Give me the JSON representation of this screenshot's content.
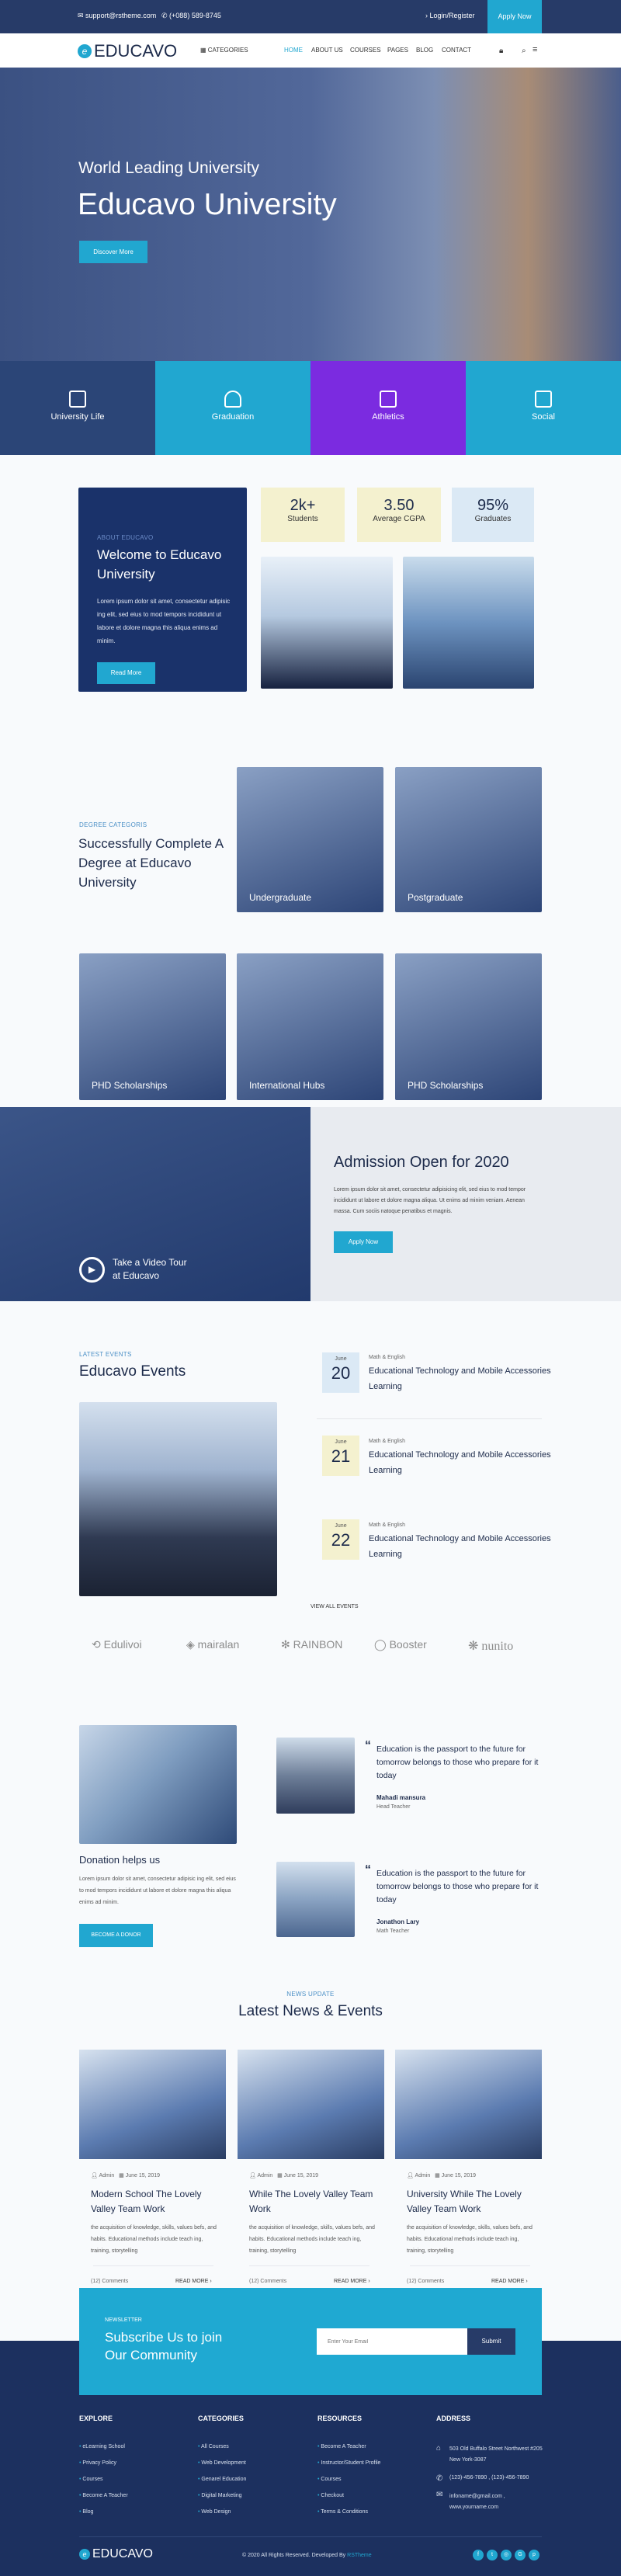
{
  "topbar": {
    "email": "support@rstheme.com",
    "phone": "(+088) 589-8745",
    "login": "Login/Register",
    "apply": "Apply Now"
  },
  "nav": {
    "logo": "EDUCAVO",
    "categories": "CATEGORIES",
    "links": [
      "HOME",
      "ABOUT US",
      "COURSES",
      "PAGES",
      "BLOG",
      "CONTACT"
    ],
    "active": "HOME"
  },
  "hero": {
    "subtitle": "World Leading University",
    "title": "Educavo University",
    "button": "Discover More"
  },
  "tiles": [
    {
      "label": "University Life",
      "color": "#2b4577"
    },
    {
      "label": "Graduation",
      "color": "#21a7d0"
    },
    {
      "label": "Athletics",
      "color": "#7b2be0"
    },
    {
      "label": "Social",
      "color": "#21a7d0"
    }
  ],
  "about": {
    "label": "ABOUT EDUCAVO",
    "title": "Welcome to Educavo University",
    "text": "Lorem ipsum dolor sit amet, consectetur adipisic ing elit, sed eius to mod tempors incididunt ut labore et dolore magna this aliqua enims ad minim.",
    "button": "Read More",
    "stats": [
      {
        "value": "2k+",
        "label": "Students"
      },
      {
        "value": "3.50",
        "label": "Average CGPA"
      },
      {
        "value": "95%",
        "label": "Graduates"
      }
    ]
  },
  "degree": {
    "label": "DEGREE CATEGORIS",
    "title": "Successfully Complete A Degree at Educavo University",
    "cards": [
      "Undergraduate",
      "Postgraduate",
      "PHD Scholarships",
      "International Hubs",
      "PHD Scholarships"
    ]
  },
  "admission": {
    "video": "Take a Video Tour at Educavo",
    "title": "Admission Open for 2020",
    "text": "Lorem ipsum dolor sit amet, consectetur adipisicing elit, sed eius to mod tempor incididunt ut labore et dolore magna aliqua. Ut enims ad minim veniam. Aenean massa. Cum sociis natoque penatibus et magnis.",
    "button": "Apply Now"
  },
  "events": {
    "label": "LATEST EVENTS",
    "title": "Educavo Events",
    "view_all": "VIEW ALL EVENTS",
    "items": [
      {
        "month": "June",
        "day": "20",
        "category": "Math & English",
        "title": "Educational Technology and Mobile Accessories Learning"
      },
      {
        "month": "June",
        "day": "21",
        "category": "Math & English",
        "title": "Educational Technology and Mobile Accessories Learning"
      },
      {
        "month": "June",
        "day": "22",
        "category": "Math & English",
        "title": "Educational Technology and Mobile Accessories Learning"
      }
    ]
  },
  "brands": [
    "Edulivoi",
    "mairalan",
    "RAINBON",
    "Booster",
    "nunito"
  ],
  "donation": {
    "title": "Donation helps us",
    "text": "Lorem ipsum dolor sit amet, consectetur adipisic ing elit, sed eius to mod tempors incididunt ut labore et dolore magna this aliqua enims ad minim.",
    "button": "BECOME A DONOR"
  },
  "testimonials": [
    {
      "quote": "Education is the passport to the future for tomorrow belongs to those who prepare for it today",
      "name": "Mahadi mansura",
      "role": "Head Teacher"
    },
    {
      "quote": "Education is the passport to the future for tomorrow belongs to those who prepare for it today",
      "name": "Jonathon Lary",
      "role": "Math Teacher"
    }
  ],
  "news": {
    "label": "NEWS UPDATE",
    "title": "Latest News & Events",
    "posts": [
      {
        "author": "Admin",
        "date": "June 15, 2019",
        "title": "Modern School The Lovely Valley Team Work",
        "text": "the acquisition of knowledge, skills, values befs, and habits. Educational methods include teach ing, training, storytelling",
        "comments": "(12) Comments",
        "more": "READ MORE"
      },
      {
        "author": "Admin",
        "date": "June 15, 2019",
        "title": "While The Lovely Valley Team Work",
        "text": "the acquisition of knowledge, skills, values befs, and habits. Educational methods include teach ing, training, storytelling",
        "comments": "(12) Comments",
        "more": "READ MORE"
      },
      {
        "author": "Admin",
        "date": "June 15, 2019",
        "title": "University While The Lovely Valley Team Work",
        "text": "the acquisition of knowledge, skills, values befs, and habits. Educational methods include teach ing, training, storytelling",
        "comments": "(12) Comments",
        "more": "READ MORE"
      }
    ]
  },
  "newsletter": {
    "label": "NEWSLETTER",
    "title": "Subscribe Us to join Our Community",
    "placeholder": "Enter Your Email",
    "submit": "Submit"
  },
  "footer": {
    "columns": [
      {
        "title": "EXPLORE",
        "items": [
          "eLearning School",
          "Privacy Policy",
          "Courses",
          "Become A Teacher",
          "Blog"
        ]
      },
      {
        "title": "CATEGORIES",
        "items": [
          "All Courses",
          "Web Development",
          "Genarel Education",
          "Digital Marketing",
          "Web Design"
        ]
      },
      {
        "title": "RESOURCES",
        "items": [
          "Become A Teacher",
          "Instructor/Student Profile",
          "Courses",
          "Checkout",
          "Terms & Conditions"
        ]
      }
    ],
    "address": {
      "title": "ADDRESS",
      "street": "503 Old Buffalo Street Northwest #205 New York-3087",
      "phone": "(123)-456-7890 , (123)-456-7890",
      "email": "infoname@gmail.com , www.yourname.com"
    },
    "logo": "EDUCAVO",
    "copyright": "© 2020 All Rights Reserved. Developed By",
    "developer": "RSTheme",
    "social": [
      "facebook",
      "twitter",
      "instagram",
      "google-plus",
      "pinterest"
    ]
  },
  "colors": {
    "navy": "#273b68",
    "accent": "#21a7d0",
    "purple": "#7b2be0",
    "footer": "#1c305f"
  }
}
